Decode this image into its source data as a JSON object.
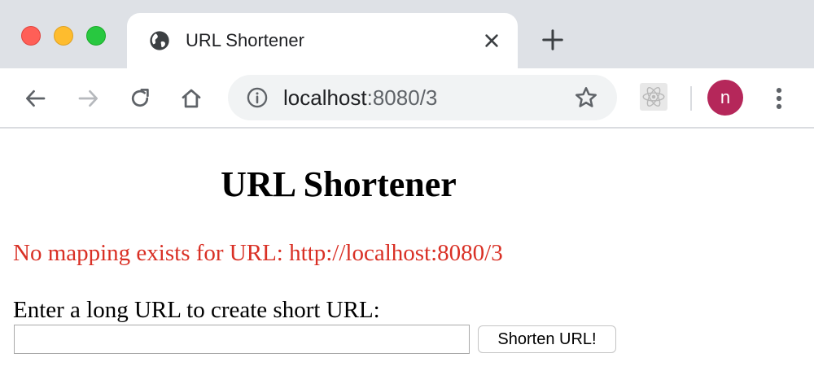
{
  "browser": {
    "tab": {
      "title": "URL Shortener",
      "favicon": "globe-icon"
    },
    "address_bar": {
      "host": "localhost",
      "rest": ":8080/3"
    },
    "profile_initial": "n",
    "colors": {
      "tab_strip": "#dee1e6",
      "avatar": "#b5275a",
      "omnibox": "#f1f3f4"
    }
  },
  "page": {
    "title": "URL Shortener",
    "error_message": "No mapping exists for URL: http://localhost:8080/3",
    "form": {
      "label": "Enter a long URL to create short URL:",
      "input_value": "",
      "button_label": "Shorten URL!"
    },
    "colors": {
      "error": "#d93025"
    }
  }
}
